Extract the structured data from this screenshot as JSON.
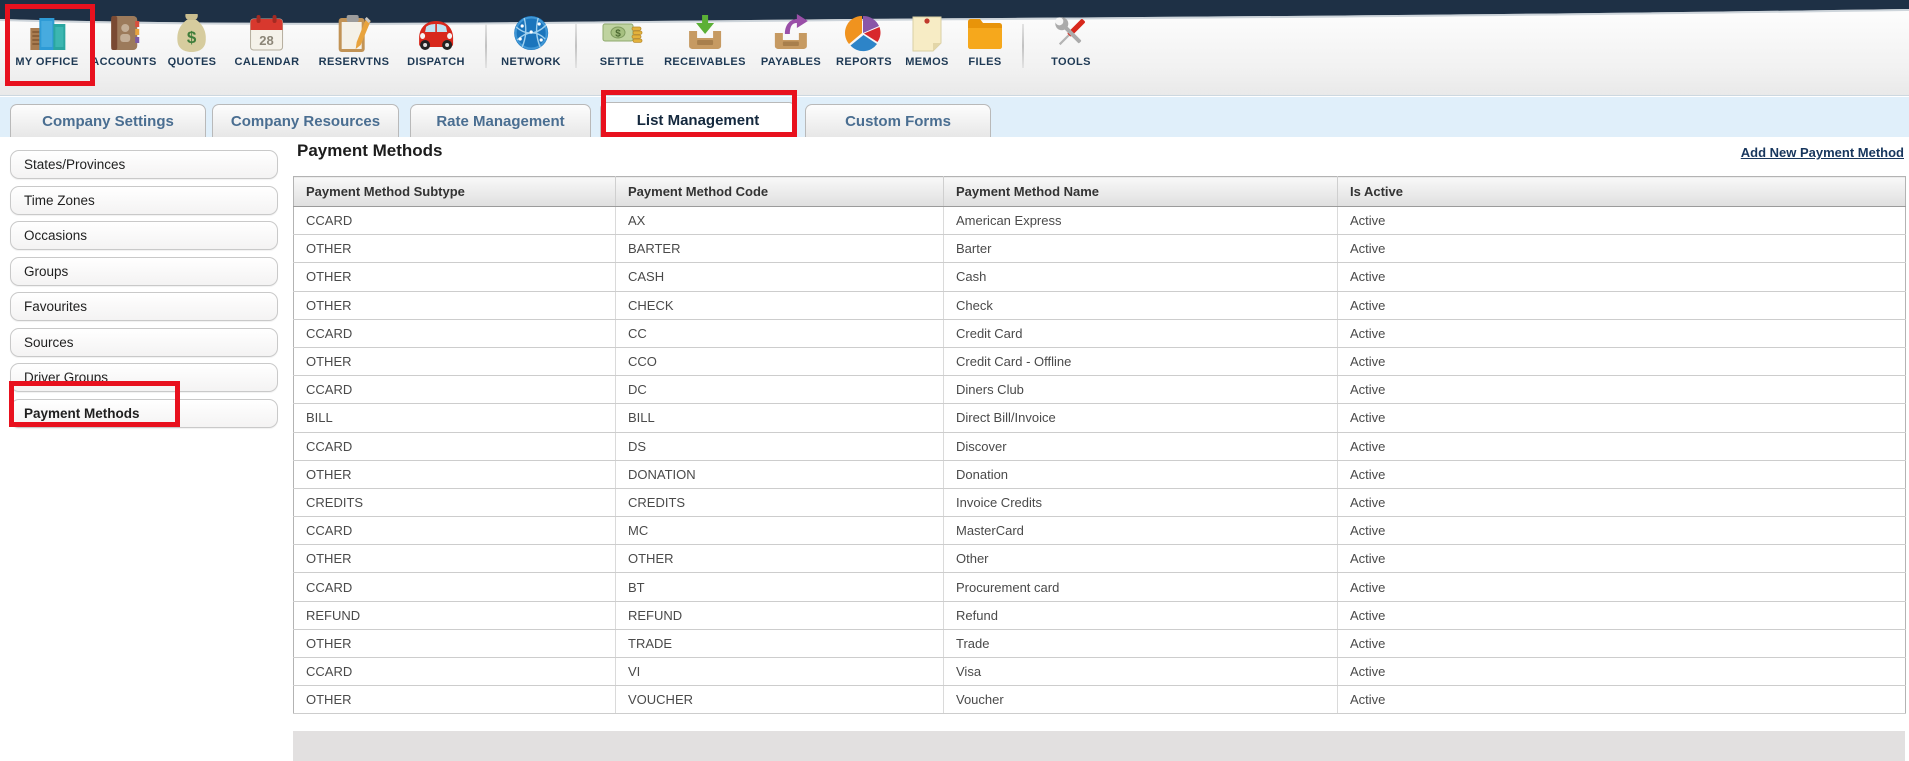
{
  "toolbar": {
    "items": [
      {
        "label": "MY OFFICE",
        "icon": "buildings-icon"
      },
      {
        "label": "ACCOUNTS",
        "icon": "address-book-icon"
      },
      {
        "label": "QUOTES",
        "icon": "money-bag-icon"
      },
      {
        "label": "CALENDAR",
        "icon": "calendar-icon",
        "calendar_day": "28"
      },
      {
        "label": "RESERVTNS",
        "icon": "clipboard-pencil-icon"
      },
      {
        "label": "DISPATCH",
        "icon": "car-icon"
      },
      {
        "label": "NETWORK",
        "icon": "globe-icon"
      },
      {
        "label": "SETTLE",
        "icon": "cash-icon"
      },
      {
        "label": "RECEIVABLES",
        "icon": "inbox-in-icon"
      },
      {
        "label": "PAYABLES",
        "icon": "outbox-out-icon"
      },
      {
        "label": "REPORTS",
        "icon": "pie-chart-icon"
      },
      {
        "label": "MEMOS",
        "icon": "sticky-note-icon"
      },
      {
        "label": "FILES",
        "icon": "folder-icon"
      },
      {
        "label": "TOOLS",
        "icon": "tools-icon"
      }
    ]
  },
  "tabs": [
    {
      "label": "Company Settings",
      "active": false
    },
    {
      "label": "Company Resources",
      "active": false
    },
    {
      "label": "Rate Management",
      "active": false
    },
    {
      "label": "List Management",
      "active": true
    },
    {
      "label": "Custom Forms",
      "active": false
    }
  ],
  "sidebar": {
    "items": [
      {
        "label": "States/Provinces",
        "selected": false
      },
      {
        "label": "Time Zones",
        "selected": false
      },
      {
        "label": "Occasions",
        "selected": false
      },
      {
        "label": "Groups",
        "selected": false
      },
      {
        "label": "Favourites",
        "selected": false
      },
      {
        "label": "Sources",
        "selected": false
      },
      {
        "label": "Driver Groups",
        "selected": false
      },
      {
        "label": "Payment Methods",
        "selected": true
      }
    ]
  },
  "main": {
    "title": "Payment Methods",
    "add_link": "Add New Payment Method",
    "table": {
      "columns": [
        "Payment Method Subtype",
        "Payment Method Code",
        "Payment Method Name",
        "Is Active"
      ],
      "rows": [
        [
          "CCARD",
          "AX",
          "American Express",
          "Active"
        ],
        [
          "OTHER",
          "BARTER",
          "Barter",
          "Active"
        ],
        [
          "OTHER",
          "CASH",
          "Cash",
          "Active"
        ],
        [
          "OTHER",
          "CHECK",
          "Check",
          "Active"
        ],
        [
          "CCARD",
          "CC",
          "Credit Card",
          "Active"
        ],
        [
          "OTHER",
          "CCO",
          "Credit Card - Offline",
          "Active"
        ],
        [
          "CCARD",
          "DC",
          "Diners Club",
          "Active"
        ],
        [
          "BILL",
          "BILL",
          "Direct Bill/Invoice",
          "Active"
        ],
        [
          "CCARD",
          "DS",
          "Discover",
          "Active"
        ],
        [
          "OTHER",
          "DONATION",
          "Donation",
          "Active"
        ],
        [
          "CREDITS",
          "CREDITS",
          "Invoice Credits",
          "Active"
        ],
        [
          "CCARD",
          "MC",
          "MasterCard",
          "Active"
        ],
        [
          "OTHER",
          "OTHER",
          "Other",
          "Active"
        ],
        [
          "CCARD",
          "BT",
          "Procurement card",
          "Active"
        ],
        [
          "REFUND",
          "REFUND",
          "Refund",
          "Active"
        ],
        [
          "OTHER",
          "TRADE",
          "Trade",
          "Active"
        ],
        [
          "CCARD",
          "VI",
          "Visa",
          "Active"
        ],
        [
          "OTHER",
          "VOUCHER",
          "Voucher",
          "Active"
        ]
      ]
    }
  },
  "annotations": {
    "color": "#E8111E",
    "highlighted": [
      "toolbar-item-my-office",
      "tab-list-management",
      "sidebar-item-payment-methods"
    ]
  },
  "colors": {
    "link": "#17365D",
    "topband": "#1E3045",
    "tabstrip_bg": "#E0EFFA"
  }
}
